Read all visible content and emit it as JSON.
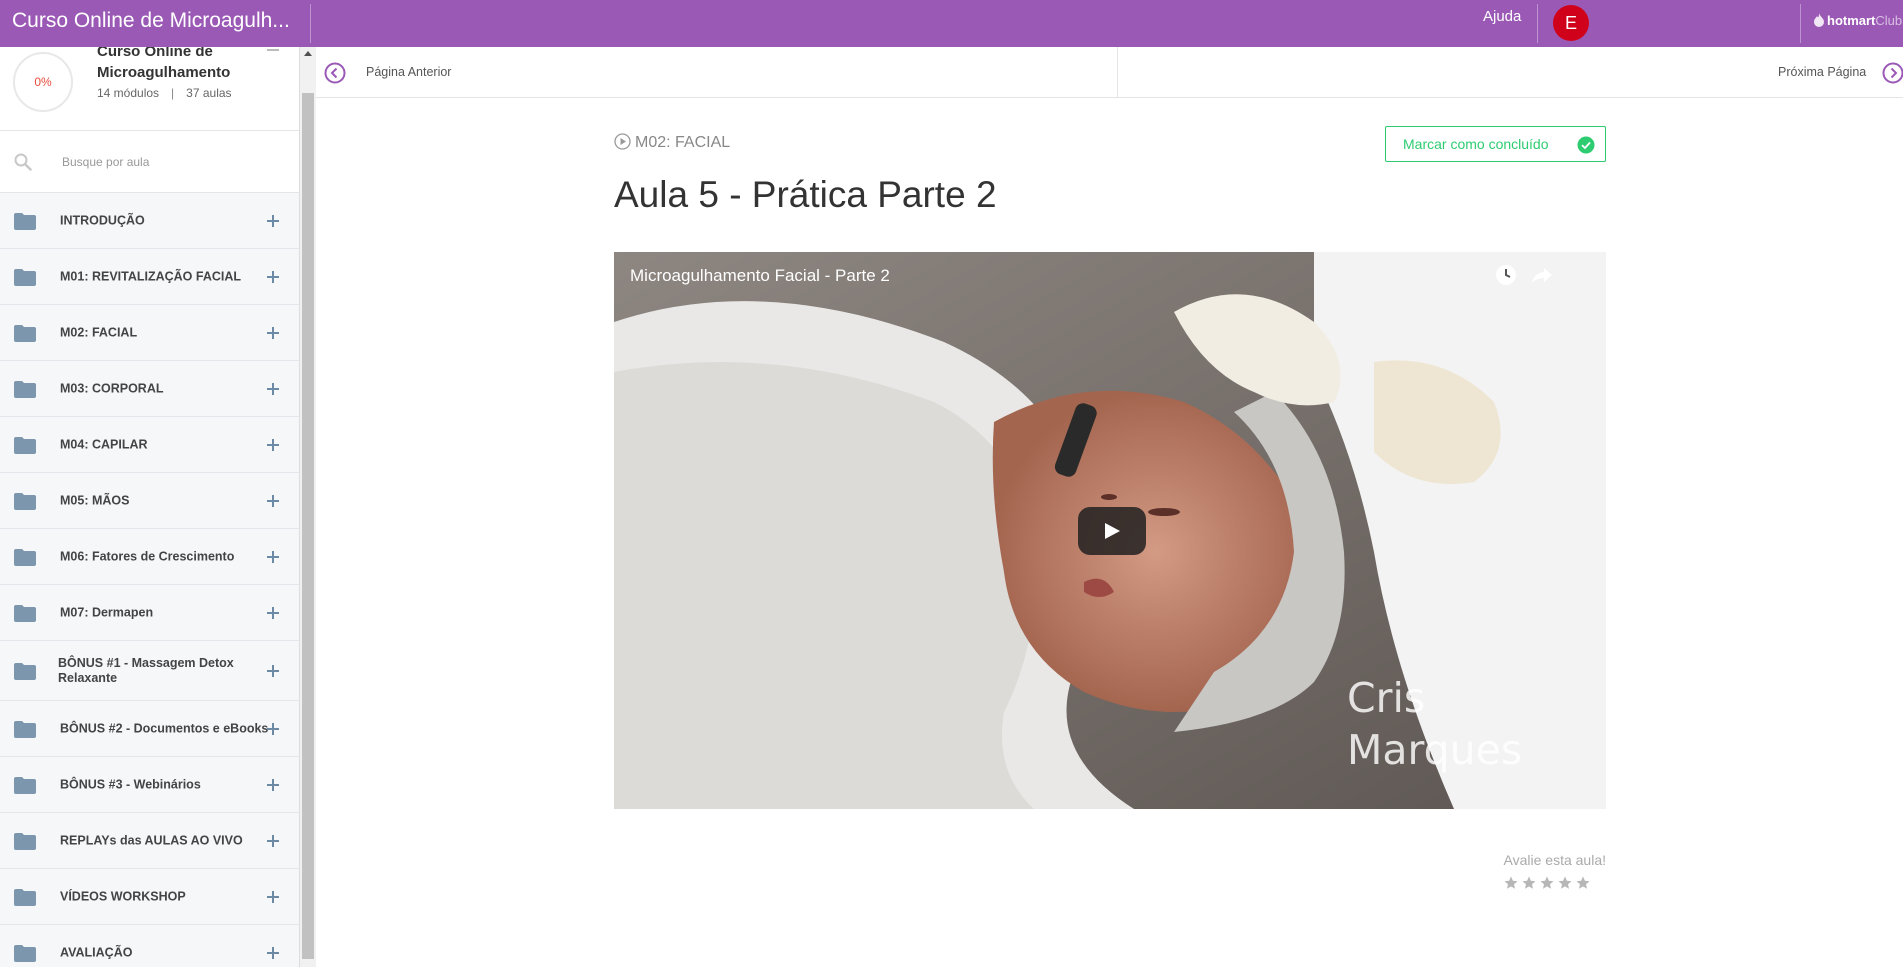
{
  "topbar": {
    "course_title": "Curso Online de Microagulh...",
    "help_label": "Ajuda",
    "avatar_initial": "E",
    "brand": "hotmart",
    "brand_suffix": "Club",
    "color": "#9b59b6",
    "avatar_color": "#d0021b"
  },
  "sidebar": {
    "progress": "0%",
    "course_name": "Curso Online de Microagulhamento",
    "modules_count": "14 módulos",
    "lessons_count": "37 aulas",
    "search_placeholder": "Busque por aula",
    "modules": [
      {
        "label": "INTRODUÇÃO",
        "icon": "folder-icon",
        "action": "plus-icon"
      },
      {
        "label": "M01: REVITALIZAÇÃO FACIAL",
        "icon": "folder-icon",
        "action": "plus-icon"
      },
      {
        "label": "M02: FACIAL",
        "icon": "folder-icon",
        "action": "plus-icon"
      },
      {
        "label": "M03: CORPORAL",
        "icon": "folder-icon",
        "action": "plus-icon"
      },
      {
        "label": "M04: CAPILAR",
        "icon": "folder-icon",
        "action": "plus-icon"
      },
      {
        "label": "M05: MÃOS",
        "icon": "folder-icon",
        "action": "plus-icon"
      },
      {
        "label": "M06: Fatores de Crescimento",
        "icon": "folder-icon",
        "action": "plus-icon"
      },
      {
        "label": "M07: Dermapen",
        "icon": "folder-icon",
        "action": "plus-icon"
      },
      {
        "label": "BÔNUS #1 - Massagem Detox Relaxante",
        "icon": "folder-icon",
        "action": "plus-icon"
      },
      {
        "label": "BÔNUS #2 - Documentos e eBooks",
        "icon": "folder-icon",
        "action": "plus-icon"
      },
      {
        "label": "BÔNUS #3 - Webinários",
        "icon": "folder-icon",
        "action": "plus-icon"
      },
      {
        "label": "REPLAYs das AULAS AO VIVO",
        "icon": "folder-icon",
        "action": "plus-icon"
      },
      {
        "label": "VÍDEOS WORKSHOP",
        "icon": "folder-icon",
        "action": "plus-icon"
      },
      {
        "label": "AVALIAÇÃO",
        "icon": "folder-icon",
        "action": "plus-icon"
      }
    ]
  },
  "pagenav": {
    "prev_label": "Página Anterior",
    "next_label": "Próxima Página"
  },
  "lesson": {
    "module_tag": "M02: FACIAL",
    "complete_label": "Marcar como concluído",
    "title": "Aula 5 - Prática Parte 2",
    "accent_color": "#2ecc71"
  },
  "video": {
    "title": "Microagulhamento Facial - Parte 2",
    "watermark": "Cris\nMarques"
  },
  "rating": {
    "label": "Avalie esta aula!",
    "stars": 5
  }
}
